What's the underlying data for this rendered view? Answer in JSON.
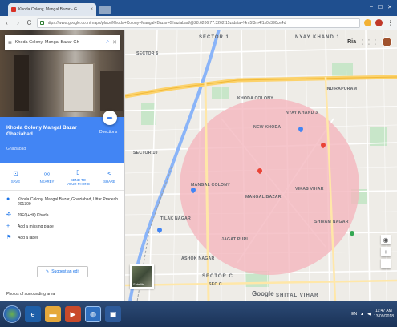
{
  "browser": {
    "tab_title": "Khoda Colony, Mangal Bazar - G",
    "tab_close": "×",
    "url": "https://www.google.co.in/maps/place/Khoda+Colony+Mangal+Bazar+Ghaziabad/@28.6206,77.3262,15z/data=!4m5!3m4!1s0x390ce4d",
    "window_controls": [
      "–",
      "☐",
      "✕"
    ],
    "nav": [
      "‹",
      "›",
      "C"
    ]
  },
  "panel": {
    "search_text": "Khoda Colony, Mangal Bazar Gh",
    "place_name": "Khoda Colony Mangal Bazar Ghaziabad",
    "place_sub": "Ghaziabad",
    "directions_label": "Directions",
    "actions": [
      {
        "label": "SAVE",
        "icon": "bookmark-icon"
      },
      {
        "label": "NEARBY",
        "icon": "nearby-icon"
      },
      {
        "label": "SEND TO YOUR PHONE",
        "icon": "phone-icon"
      },
      {
        "label": "SHARE",
        "icon": "share-icon"
      }
    ],
    "info_rows": [
      {
        "icon": "location-pin-icon",
        "text": "Khoda Colony, Mangal Bazar, Ghaziabad, Uttar Pradesh 201309"
      },
      {
        "icon": "plus-code-icon",
        "text": "J9FQ+HQ Khoda"
      },
      {
        "icon": "add-place-icon",
        "text": "Add a missing place"
      },
      {
        "icon": "label-icon",
        "text": "Add a label"
      }
    ],
    "suggest_label": "Suggest an edit",
    "photos_header": "Photos of surrounding area"
  },
  "map": {
    "labels": {
      "sector_top": "SECTOR 1",
      "nyay_khand": "NYAY KHAND 1",
      "sector_left": "SECTOR 6",
      "sector_c": "SECTOR C",
      "sector_c2": "SEC C",
      "shital_vihar": "SHITAL VIHAR",
      "khoda_colony": "KHODA COLONY",
      "new_khoda": "NEW KHODA",
      "mangal_bazar": "MANGAL BAZAR",
      "mangal_colony": "MANGAL COLONY",
      "nyay_khand3": "NYAY KHAND 3",
      "sector10": "SECTOR 10",
      "vikas": "VIKAS VIHAR",
      "tilak": "TILAK NAGAR",
      "jagat": "JAGAT PURI",
      "shivam": "SHIVAM NAGAR",
      "indirapuram": "INDIRAPURAM",
      "ashok": "ASHOK NAGAR"
    },
    "google_logo": "Google",
    "satellite_label": "Satellite",
    "zoom_in": "+",
    "zoom_out": "−",
    "user_initial": "Ria",
    "apps_icon": "⋮⋮⋮"
  },
  "colors": {
    "accent": "#4285f4",
    "highlight": "#f4b6be",
    "road_major": "#fcd26b",
    "water": "#8ab4f8",
    "park": "#c8e6c9"
  },
  "taskbar": {
    "lang": "EN",
    "time": "11:47 AM",
    "date": "13/09/2018"
  }
}
